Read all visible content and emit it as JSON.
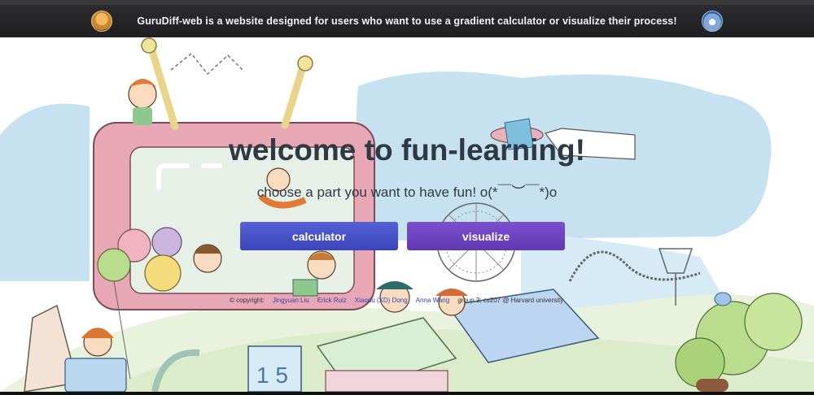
{
  "banner": {
    "text": "GuruDiff-web is a website designed for users who want to use a gradient calculator or visualize their process!",
    "left_icon": "user-avatar-icon",
    "right_icon": "globe-avatar-icon"
  },
  "main": {
    "title": "welcome to fun-learning!",
    "subtitle": "choose a part you want to have fun! o(*￣︶￣*)o",
    "buttons": {
      "calculator": "calculator",
      "visualize": "visualize"
    }
  },
  "footer": {
    "copyright": "© copyright:",
    "authors": [
      "Jingyuan Liu",
      "Erick Ruiz",
      "Xiaodu (XD) Dong",
      "Anna Wang"
    ],
    "group": "group 3; cs207 @ Harvard university"
  },
  "colors": {
    "calculator_button": "#4a53c9",
    "visualize_button": "#6f44c0",
    "title": "#2e3944",
    "sky_blob": "#c6e2f1"
  }
}
